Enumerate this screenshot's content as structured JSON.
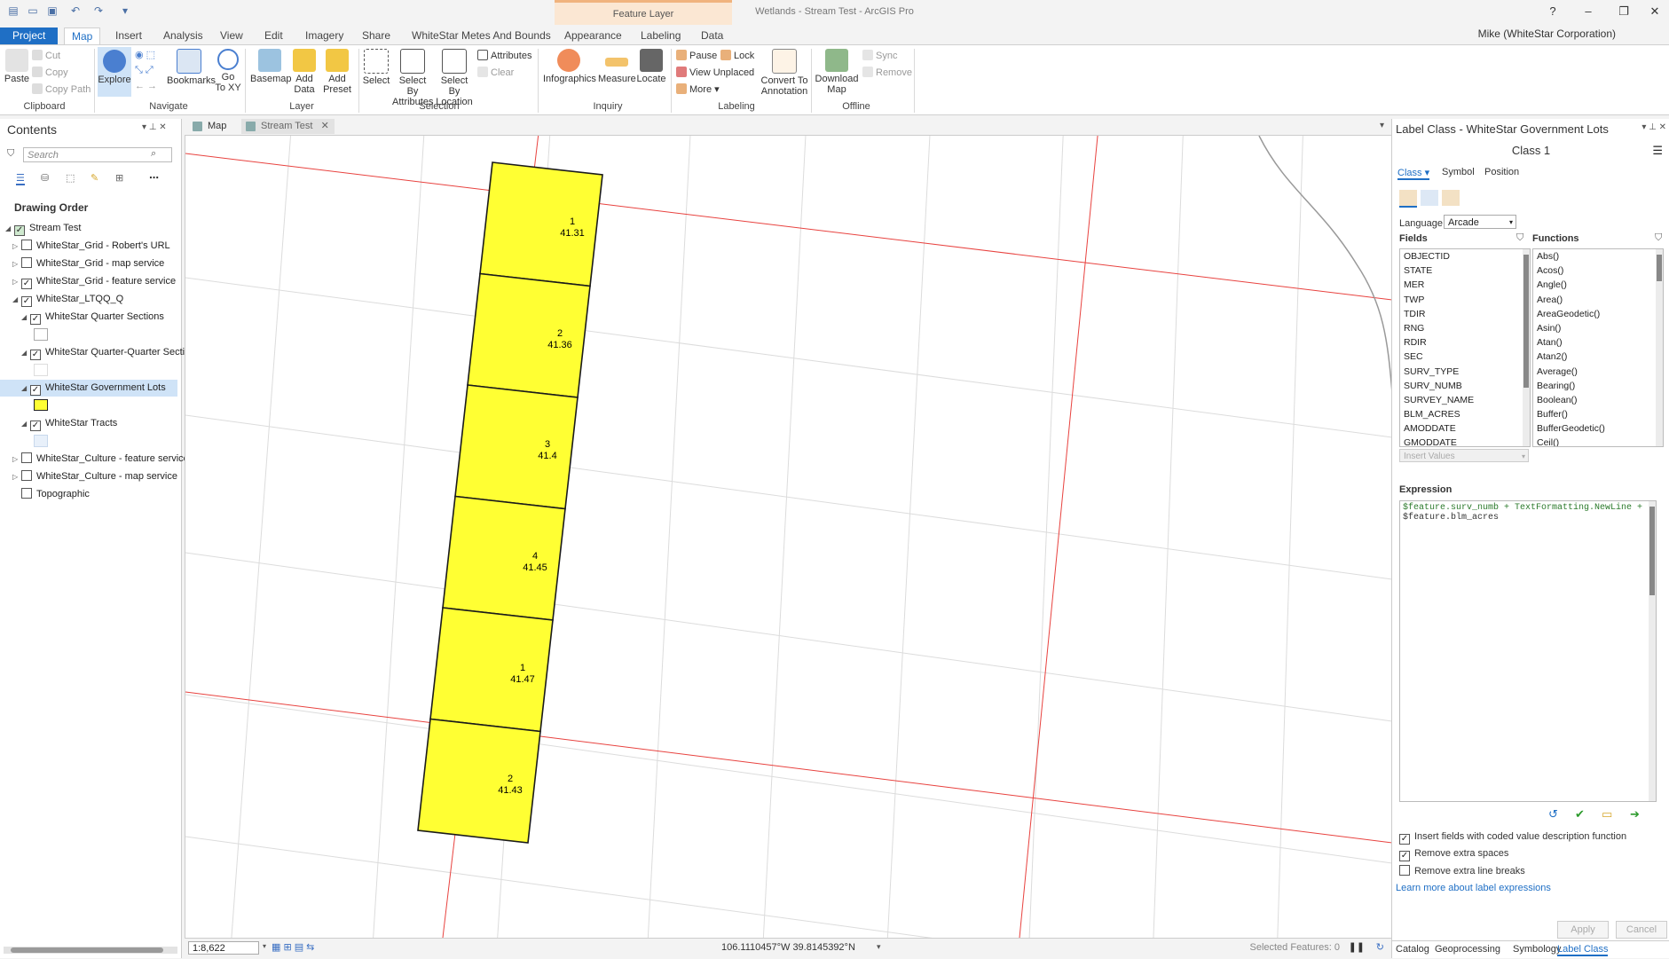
{
  "window": {
    "title": "Wetlands - Stream Test - ArcGIS Pro",
    "contextual_tab": "Feature Layer"
  },
  "ribbon_tabs": [
    "Project",
    "Map",
    "Insert",
    "Analysis",
    "View",
    "Edit",
    "Imagery",
    "Share",
    "WhiteStar Metes And Bounds",
    "Appearance",
    "Labeling",
    "Data"
  ],
  "user": "Mike (WhiteStar Corporation)",
  "ribbon": {
    "clipboard": {
      "paste": "Paste",
      "cut": "Cut",
      "copy": "Copy",
      "copy_path": "Copy Path",
      "group": "Clipboard"
    },
    "navigate": {
      "explore": "Explore",
      "bookmarks": "Bookmarks",
      "goto_1": "Go",
      "goto_2": "To XY",
      "group": "Navigate"
    },
    "layer": {
      "basemap": "Basemap",
      "add_data_1": "Add",
      "add_data_2": "Data",
      "add_preset_1": "Add",
      "add_preset_2": "Preset",
      "group": "Layer"
    },
    "selection": {
      "select": "Select",
      "by_attr_1": "Select By",
      "by_attr_2": "Attributes",
      "by_loc_1": "Select By",
      "by_loc_2": "Location",
      "attributes": "Attributes",
      "clear": "Clear",
      "group": "Selection"
    },
    "inquiry": {
      "infographics": "Infographics",
      "measure": "Measure",
      "locate": "Locate",
      "group": "Inquiry"
    },
    "labeling": {
      "pause": "Pause",
      "lock": "Lock",
      "view_unplaced": "View Unplaced",
      "more": "More",
      "convert_1": "Convert To",
      "convert_2": "Annotation",
      "group": "Labeling"
    },
    "offline": {
      "download_1": "Download",
      "download_2": "Map",
      "sync": "Sync",
      "remove": "Remove",
      "group": "Offline"
    }
  },
  "contents": {
    "title": "Contents",
    "search_placeholder": "Search",
    "drawing_order": "Drawing Order",
    "layers": [
      {
        "label": "Stream Test",
        "checked": true
      },
      {
        "label": "WhiteStar_Grid - Robert's URL",
        "checked": false
      },
      {
        "label": "WhiteStar_Grid - map service",
        "checked": false
      },
      {
        "label": "WhiteStar_Grid - feature service",
        "checked": true
      },
      {
        "label": "WhiteStar_LTQQ_Q",
        "checked": true
      },
      {
        "label": "WhiteStar Quarter Sections",
        "checked": true
      },
      {
        "label": "WhiteStar Quarter-Quarter Sections",
        "checked": true
      },
      {
        "label": "WhiteStar Government Lots",
        "checked": true
      },
      {
        "label": "WhiteStar Tracts",
        "checked": true
      },
      {
        "label": "WhiteStar_Culture - feature service",
        "checked": false
      },
      {
        "label": "WhiteStar_Culture - map service",
        "checked": false
      },
      {
        "label": "Topographic",
        "checked": false
      }
    ]
  },
  "map_tabs": [
    "Map",
    "Stream Test"
  ],
  "map": {
    "lot_fill": "#ffff33",
    "lots": [
      {
        "number": "1",
        "acres": "41.31"
      },
      {
        "number": "2",
        "acres": "41.36"
      },
      {
        "number": "3",
        "acres": "41.4"
      },
      {
        "number": "4",
        "acres": "41.45"
      },
      {
        "number": "1",
        "acres": "41.47"
      },
      {
        "number": "2",
        "acres": "41.43"
      }
    ]
  },
  "status": {
    "scale": "1:8,622",
    "coords": "106.1110457°W 39.8145392°N",
    "selected": "Selected Features: 0"
  },
  "label_pane": {
    "title": "Label Class - WhiteStar Government Lots",
    "class_name": "Class 1",
    "tabs": [
      "Class",
      "Symbol",
      "Position"
    ],
    "language_label": "Language",
    "language_value": "Arcade",
    "fields_label": "Fields",
    "functions_label": "Functions",
    "fields": [
      "OBJECTID",
      "STATE",
      "MER",
      "TWP",
      "TDIR",
      "RNG",
      "RDIR",
      "SEC",
      "SURV_TYPE",
      "SURV_NUMB",
      "SURVEY_NAME",
      "BLM_ACRES",
      "AMODDATE",
      "GMODDATE"
    ],
    "functions": [
      "Abs()",
      "Acos()",
      "Angle()",
      "Area()",
      "AreaGeodetic()",
      "Asin()",
      "Atan()",
      "Atan2()",
      "Average()",
      "Bearing()",
      "Boolean()",
      "Buffer()",
      "BufferGeodetic()",
      "Ceil()"
    ],
    "insert_values": "Insert Values",
    "expression_label": "Expression",
    "expression_line1": "$feature.surv_numb + TextFormatting.NewLine +",
    "expression_line2": "$feature.blm_acres",
    "opt_coded": "Insert fields with coded value description function",
    "opt_spaces": "Remove extra spaces",
    "opt_breaks": "Remove extra line breaks",
    "learn_more": "Learn more about label expressions",
    "apply": "Apply",
    "cancel": "Cancel",
    "bottom_tabs": [
      "Catalog",
      "Geoprocessing",
      "Symbology",
      "Label Class"
    ]
  }
}
